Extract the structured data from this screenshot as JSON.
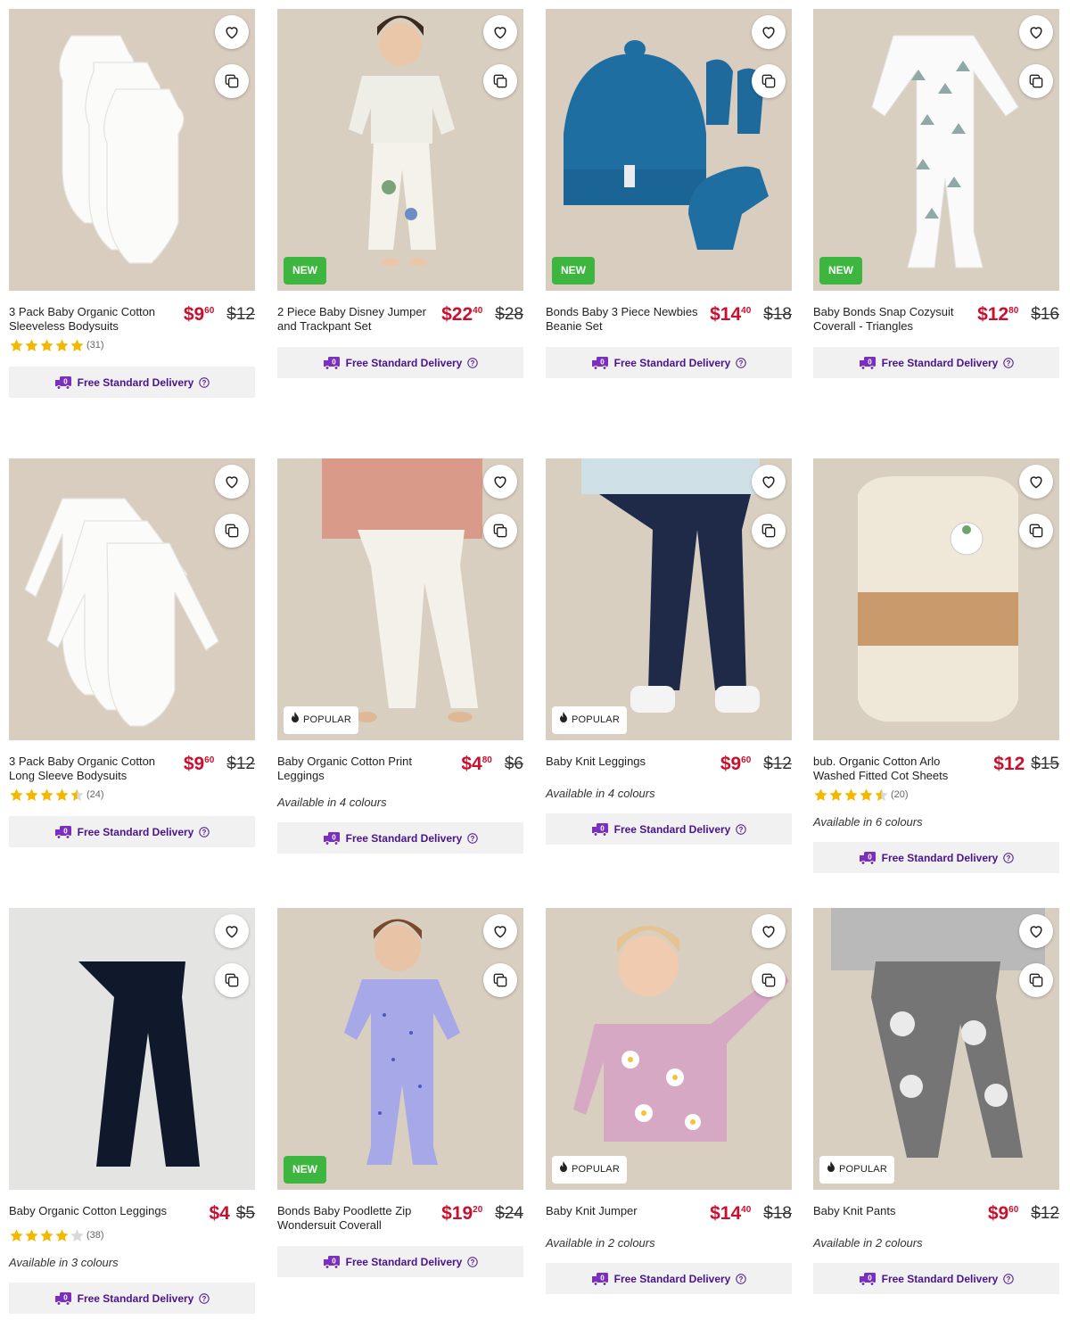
{
  "delivery_label": "Free Standard Delivery",
  "colors": {
    "price_red": "#c8102e",
    "new_green": "#3cb63f",
    "delivery_purple": "#4a148c",
    "star_yellow": "#f5b800"
  },
  "products": [
    {
      "title": "3 Pack Baby Organic Cotton Sleeveless Bodysuits",
      "price_dollars": "$9",
      "price_cents": "60",
      "was": "$12",
      "rating": 5,
      "reviews": "(31)",
      "badge": "",
      "avail": "",
      "image": "white-sleeveless-bodysuits"
    },
    {
      "title": "2 Piece Baby Disney Jumper and Trackpant Set",
      "price_dollars": "$22",
      "price_cents": "40",
      "was": "$28",
      "rating": 0,
      "reviews": "",
      "badge": "NEW",
      "avail": "",
      "image": "toddler-disney-set"
    },
    {
      "title": "Bonds Baby 3 Piece Newbies Beanie Set",
      "price_dollars": "$14",
      "price_cents": "40",
      "was": "$18",
      "rating": 0,
      "reviews": "",
      "badge": "NEW",
      "avail": "",
      "image": "blue-beanie-mittens-socks"
    },
    {
      "title": "Baby Bonds Snap Cozysuit Coverall - Triangles",
      "price_dollars": "$12",
      "price_cents": "80",
      "was": "$16",
      "rating": 0,
      "reviews": "",
      "badge": "NEW",
      "avail": "",
      "image": "triangle-coverall"
    },
    {
      "title": "3 Pack Baby Organic Cotton Long Sleeve Bodysuits",
      "price_dollars": "$9",
      "price_cents": "60",
      "was": "$12",
      "rating": 4.5,
      "reviews": "(24)",
      "badge": "",
      "avail": "",
      "image": "white-longsleeve-bodysuits"
    },
    {
      "title": "Baby Organic Cotton Print Leggings",
      "price_dollars": "$4",
      "price_cents": "80",
      "was": "$6",
      "rating": 0,
      "reviews": "",
      "badge": "POPULAR",
      "avail": "Available in 4 colours",
      "image": "print-leggings"
    },
    {
      "title": "Baby Knit Leggings",
      "price_dollars": "$9",
      "price_cents": "60",
      "was": "$12",
      "rating": 0,
      "reviews": "",
      "badge": "POPULAR",
      "avail": "Available in 4 colours",
      "image": "navy-knit-leggings"
    },
    {
      "title": "bub. Organic Cotton Arlo Washed Fitted Cot Sheets",
      "price_dollars": "$12",
      "price_cents": "",
      "was": "$15",
      "rating": 4.5,
      "reviews": "(20)",
      "badge": "",
      "avail": "Available in 6 colours",
      "image": "cot-sheet-package"
    },
    {
      "title": "Baby Organic Cotton Leggings",
      "price_dollars": "$4",
      "price_cents": "",
      "was": "$5",
      "rating": 4,
      "reviews": "(38)",
      "badge": "",
      "avail": "Available in 3 colours",
      "image": "navy-leggings"
    },
    {
      "title": "Bonds Baby Poodlette Zip Wondersuit Coverall",
      "price_dollars": "$19",
      "price_cents": "20",
      "was": "$24",
      "rating": 0,
      "reviews": "",
      "badge": "NEW",
      "avail": "",
      "image": "purple-wondersuit"
    },
    {
      "title": "Baby Knit Jumper",
      "price_dollars": "$14",
      "price_cents": "40",
      "was": "$18",
      "rating": 0,
      "reviews": "",
      "badge": "POPULAR",
      "avail": "Available in 2 colours",
      "image": "pink-daisy-jumper"
    },
    {
      "title": "Baby Knit Pants",
      "price_dollars": "$9",
      "price_cents": "60",
      "was": "$12",
      "rating": 0,
      "reviews": "",
      "badge": "POPULAR",
      "avail": "Available in 2 colours",
      "image": "koala-knit-pants"
    }
  ]
}
